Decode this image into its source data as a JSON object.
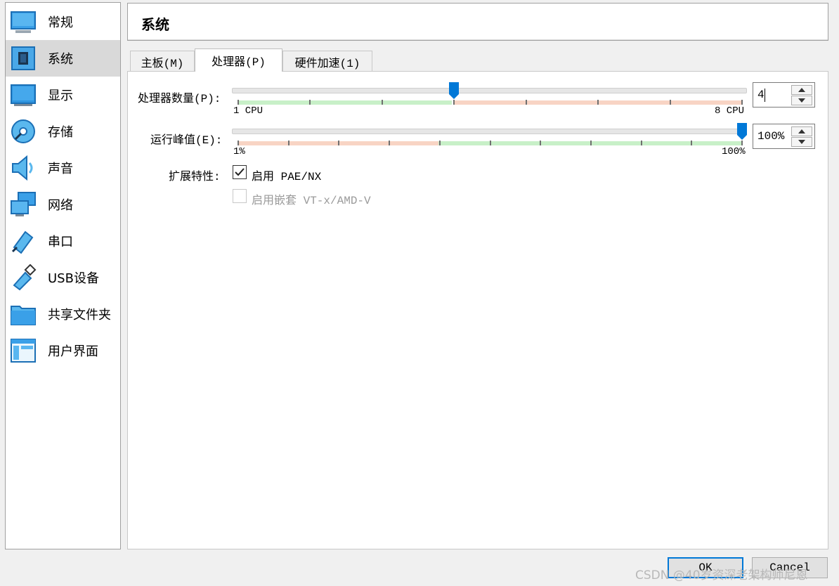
{
  "sidebar": {
    "items": [
      {
        "label": "常规",
        "icon": "monitor-icon"
      },
      {
        "label": "系统",
        "icon": "chip-icon",
        "selected": true
      },
      {
        "label": "显示",
        "icon": "display-icon"
      },
      {
        "label": "存储",
        "icon": "disk-icon"
      },
      {
        "label": "声音",
        "icon": "speaker-icon"
      },
      {
        "label": "网络",
        "icon": "network-icon"
      },
      {
        "label": "串口",
        "icon": "serial-port-icon"
      },
      {
        "label": "USB设备",
        "icon": "usb-icon"
      },
      {
        "label": "共享文件夹",
        "icon": "folder-icon"
      },
      {
        "label": "用户界面",
        "icon": "window-icon"
      }
    ]
  },
  "header": {
    "title": "系统"
  },
  "tabs": [
    {
      "label": "主板(M)"
    },
    {
      "label": "处理器(P)",
      "active": true
    },
    {
      "label": "硬件加速(1)"
    }
  ],
  "processor": {
    "cpu_count_label": "处理器数量(P):",
    "cpu_min_label": "1 CPU",
    "cpu_max_label": "8 CPU",
    "cpu_value": "4",
    "cpu_min": 1,
    "cpu_max": 8,
    "cpu_selected": 4,
    "exec_cap_label": "运行峰值(E):",
    "exec_min_label": "1%",
    "exec_max_label": "100%",
    "exec_value": "100%",
    "exec_selected_percent": 100,
    "ext_features_label": "扩展特性:",
    "pae_label": "启用 PAE/NX",
    "pae_checked": true,
    "nested_label": "启用嵌套 VT-x/AMD-V",
    "nested_checked": false
  },
  "footer": {
    "ok_label": "OK",
    "cancel_label": "Cancel"
  },
  "watermark": "CSDN @40岁资深老架构师尼恩",
  "colors": {
    "accent": "#0078d7",
    "green_range": "#c8f0c8",
    "red_range": "#f8d4c4",
    "selected_bg": "#d9d9d9"
  }
}
